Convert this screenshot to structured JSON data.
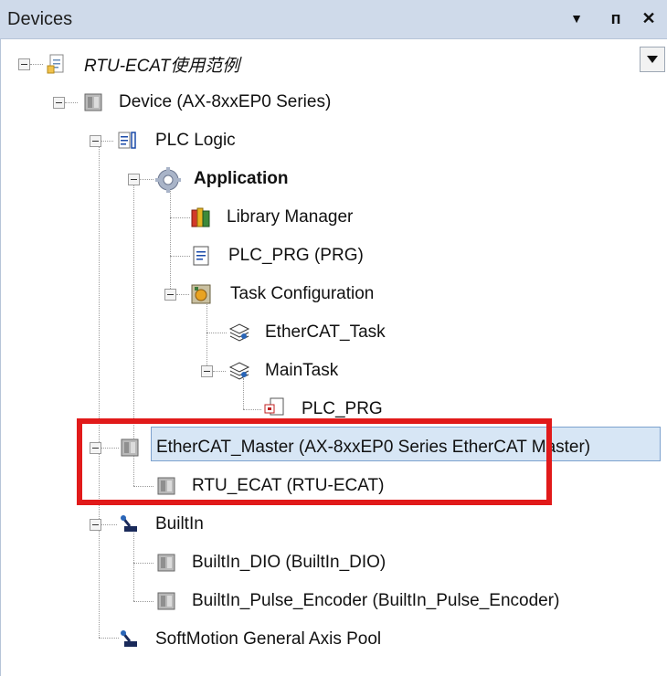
{
  "panel": {
    "title": "Devices",
    "controls": {
      "dropdown": "▼",
      "pin": "ᴨ",
      "close": "✕"
    }
  },
  "tree": [
    {
      "label": "RTU-ECAT使用范例",
      "icon": "project-file-icon"
    },
    {
      "label": "Device (AX-8xxEP0 Series)",
      "icon": "device-icon"
    },
    {
      "label": "PLC Logic",
      "icon": "plc-logic-icon"
    },
    {
      "label": "Application",
      "icon": "application-gear-icon"
    },
    {
      "label": "Library Manager",
      "icon": "library-books-icon"
    },
    {
      "label": "PLC_PRG (PRG)",
      "icon": "pou-document-icon"
    },
    {
      "label": "Task Configuration",
      "icon": "task-configuration-icon"
    },
    {
      "label": "EtherCAT_Task",
      "icon": "task-stack-icon"
    },
    {
      "label": "MainTask",
      "icon": "task-stack-icon"
    },
    {
      "label": "PLC_PRG",
      "icon": "pou-call-icon"
    },
    {
      "label": "EtherCAT_Master (AX-8xxEP0 Series EtherCAT Master)",
      "icon": "device-icon"
    },
    {
      "label": "RTU_ECAT (RTU-ECAT)",
      "icon": "device-icon"
    },
    {
      "label": "BuiltIn",
      "icon": "axis-icon"
    },
    {
      "label": "BuiltIn_DIO (BuiltIn_DIO)",
      "icon": "device-icon"
    },
    {
      "label": "BuiltIn_Pulse_Encoder (BuiltIn_Pulse_Encoder)",
      "icon": "device-icon"
    },
    {
      "label": "SoftMotion General Axis Pool",
      "icon": "axis-icon"
    }
  ],
  "colors": {
    "titlebar": "#cfdaea",
    "selection": "#d7e6f5",
    "highlight_box": "#e11a1a"
  }
}
